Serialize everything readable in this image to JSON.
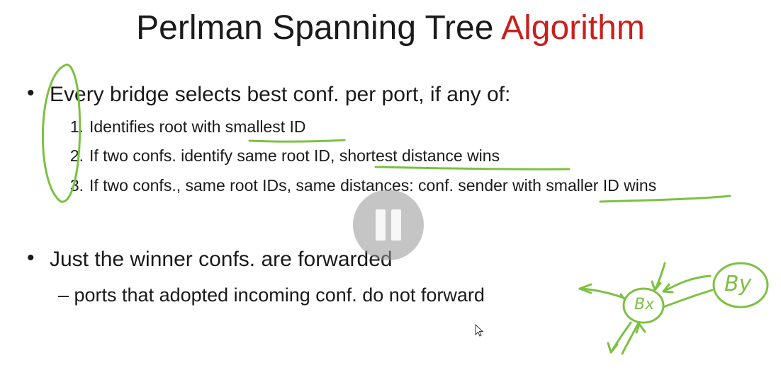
{
  "slide": {
    "title_main": "Perlman Spanning Tree ",
    "title_accent": "Algorithm",
    "bullet1": "Every bridge selects best conf. per port, if any of:",
    "items": [
      {
        "num": "1.",
        "text_plain": "Identifies root with ",
        "text_marked": "smallest ID"
      },
      {
        "num": "2.",
        "text_plain": "If two confs. identify same root ID, ",
        "text_marked": "shortest distance wins"
      },
      {
        "num": "3.",
        "text_plain": "If two confs., same root IDs, same distances: conf. sender with ",
        "text_marked": "smaller ID wins"
      }
    ],
    "bullet2": "Just the winner confs. are forwarded",
    "sub_bullet": "– ports that adopted incoming conf. do not forward"
  },
  "colors": {
    "accent": "#c8201e",
    "ink": "#7cc142"
  },
  "player": {
    "state": "paused",
    "pause_icon": "pause-icon"
  },
  "annotations": {
    "bridge_x_label": "Bx",
    "bridge_y_label": "By"
  }
}
